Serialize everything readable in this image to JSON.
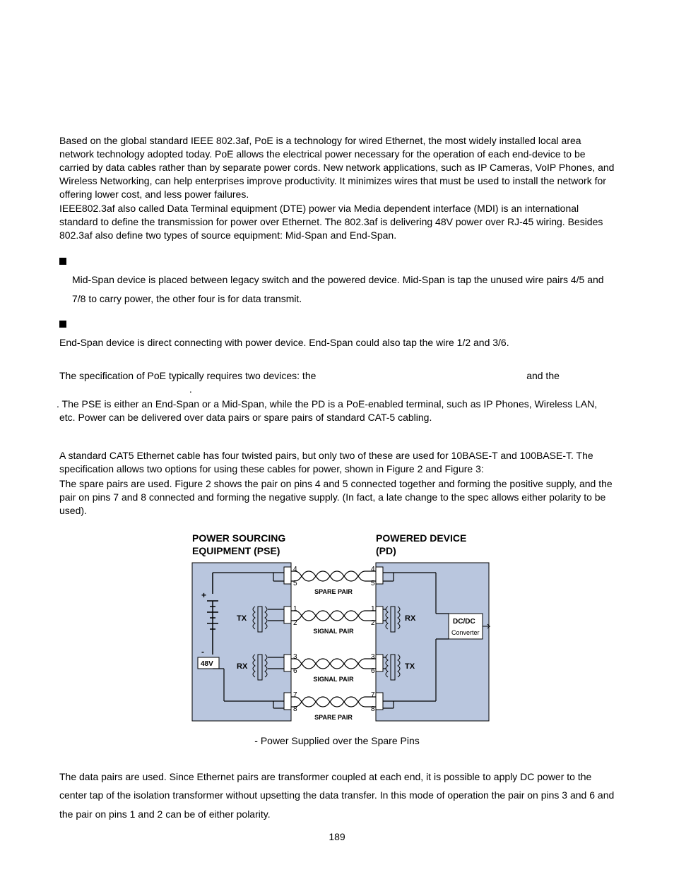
{
  "paragraphs": {
    "intro1": "Based on the global standard IEEE 802.3af, PoE is a technology for wired Ethernet, the most widely installed local area network technology adopted today. PoE allows the electrical power necessary for the operation of each end-device to be carried by data cables rather than by separate power cords. New network applications, such as IP Cameras, VoIP Phones, and Wireless Networking, can help enterprises improve productivity. It minimizes wires that must be used to install the network for offering lower cost, and less power failures.",
    "intro2": "IEEE802.3af also called Data Terminal equipment (DTE) power via Media dependent interface (MDI) is an international standard to define the transmission for power over Ethernet. The 802.3af is delivering 48V power over RJ-45 wiring. Besides 802.3af also define two types of source equipment: Mid-Span and End-Span.",
    "bullet1": "Mid-Span device is placed between legacy switch and the powered device. Mid-Span is tap the unused wire pairs 4/5 and 7/8 to carry power, the other four is for data transmit.",
    "bullet2": "End-Span device is direct connecting with power device. End-Span could also tap the wire 1/2 and 3/6.",
    "spec_pre": "The specification of PoE typically requires two devices: the ",
    "spec_mid": " and the ",
    "spec_post": ". The PSE is either an End-Span or a Mid-Span, while the PD is a PoE-enabled terminal, such as IP Phones, Wireless LAN, etc. Power can be delivered over data pairs or spare pairs of standard CAT-5 cabling.",
    "cat5a": "A standard CAT5 Ethernet cable has four twisted pairs, but only two of these are used for 10BASE-T and 100BASE-T. The specification allows two options for using these cables for power, shown in Figure 2 and Figure 3:",
    "cat5b": "The spare pairs are used. Figure 2 shows the pair on pins 4 and 5 connected together and forming the positive supply, and the pair on pins 7 and 8 connected and forming the negative supply. (In fact, a late change to the spec allows either polarity to be used).",
    "data_pairs": "The data pairs are used. Since Ethernet pairs are transformer coupled at each end, it is possible to apply DC power to the center tap of the isolation transformer without upsetting the data transfer. In this mode of operation the pair on pins 3 and 6 and the pair on pins 1 and 2 can be of either polarity."
  },
  "figure": {
    "title_left": "POWER SOURCING",
    "title_left2": "EQUIPMENT (PSE)",
    "title_right": "POWERED DEVICE",
    "title_right2": "(PD)",
    "caption": " - Power Supplied over the Spare Pins",
    "labels": {
      "spare_pair": "SPARE PAIR",
      "signal_pair": "SIGNAL PAIR",
      "tx": "TX",
      "rx": "RX",
      "v48": "48V",
      "dcdc": "DC/DC",
      "conv": "Converter",
      "plus": "+",
      "minus": "-"
    },
    "pins": {
      "p1": "1",
      "p2": "2",
      "p3": "3",
      "p4": "4",
      "p5": "5",
      "p6": "6",
      "p7": "7",
      "p8": "8"
    }
  },
  "page_number": "189"
}
